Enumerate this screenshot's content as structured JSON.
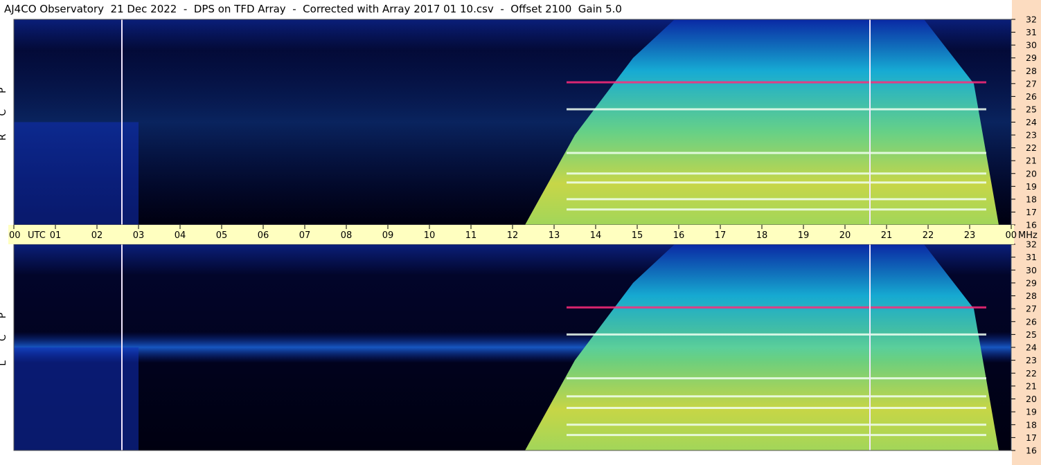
{
  "title": "AJ4CO Observatory  21 Dec 2022  -  DPS on TFD Array  -  Corrected with Array 2017 01 10.csv  -  Offset 2100  Gain 5.0",
  "colors": {
    "background": "#ffffff",
    "freq_strip": "#fcdcc0",
    "time_strip": "#ffffc0",
    "spectrogram_quiet": "#000010",
    "spectrogram_low": "#0a2aa8",
    "spectrogram_mid": "#1ac8e0",
    "spectrogram_high": "#e8e83a",
    "spectrogram_peak": "#ff2a7a"
  },
  "chart_data": [
    {
      "type": "heatmap",
      "panel": "RCP",
      "ylabel_letters": [
        "P",
        "C",
        "R"
      ],
      "y_ticks": [
        "16",
        "17",
        "18",
        "19",
        "20",
        "21",
        "22",
        "23",
        "24",
        "25",
        "26",
        "27",
        "28",
        "29",
        "30",
        "31",
        "32"
      ],
      "ylim": [
        16,
        32
      ],
      "x_ticks": [
        "00",
        "01",
        "02",
        "03",
        "04",
        "05",
        "06",
        "07",
        "08",
        "09",
        "10",
        "11",
        "12",
        "13",
        "14",
        "15",
        "16",
        "17",
        "18",
        "19",
        "20",
        "21",
        "22",
        "23",
        "00"
      ],
      "xlim": [
        0,
        24
      ],
      "x_units_label": "UTC",
      "y_units_label": "MHz",
      "activity_window_utc": [
        12.3,
        23.7
      ],
      "noise_band_mhz": [
        16,
        32
      ],
      "strong_bands_mhz": [
        17.2,
        18,
        19.3,
        20,
        21.6,
        25,
        27.1
      ],
      "vertical_markers_utc": [
        2.6,
        20.6
      ]
    },
    {
      "type": "heatmap",
      "panel": "LCP",
      "ylabel_letters": [
        "P",
        "C",
        "L"
      ],
      "y_ticks": [
        "16",
        "17",
        "18",
        "19",
        "20",
        "21",
        "22",
        "23",
        "24",
        "25",
        "26",
        "27",
        "28",
        "29",
        "30",
        "31",
        "32"
      ],
      "ylim": [
        16,
        32
      ],
      "x_ticks": [
        "00",
        "01",
        "02",
        "03",
        "04",
        "05",
        "06",
        "07",
        "08",
        "09",
        "10",
        "11",
        "12",
        "13",
        "14",
        "15",
        "16",
        "17",
        "18",
        "19",
        "20",
        "21",
        "22",
        "23",
        "00"
      ],
      "xlim": [
        0,
        24
      ],
      "x_units_label": "UTC",
      "y_units_label": "MHz",
      "activity_window_utc": [
        12.3,
        23.7
      ],
      "noise_band_mhz": [
        22.8,
        25.2
      ],
      "strong_bands_mhz": [
        17.2,
        18,
        19.3,
        20.2,
        21.6,
        25,
        27.1
      ],
      "vertical_markers_utc": [
        2.6,
        20.6
      ]
    }
  ]
}
